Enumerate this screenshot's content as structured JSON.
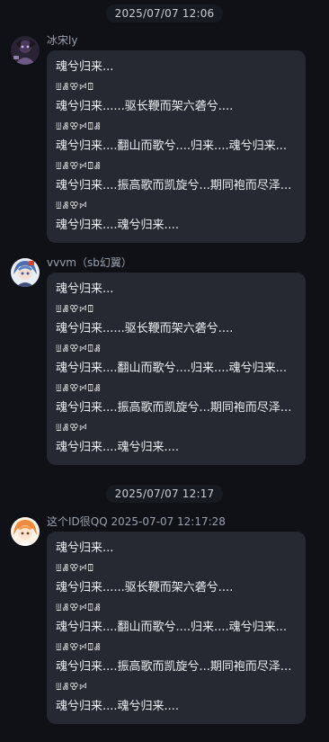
{
  "timestamps": {
    "first": "2025/07/07 12:06",
    "second": "2025/07/07 12:17"
  },
  "messages": [
    {
      "sender": "冰宋ly",
      "avatar_icon": "dark-anime-avatar-icon",
      "lines": [
        "魂兮归来...",
        "ꔗꗡꕢꗯꘖ",
        "魂兮归来......驱长鞭而架六砻兮....",
        "ꔗꗡꕢꗯꘖꗡ",
        "魂兮归来....翻山而歌兮....归来....魂兮归来...",
        "ꔗꗡꕢꗯꘖꗡ",
        "魂兮归来....振高歌而凯旋兮...期同袍而尽泽...",
        "ꔗꗡꕢꗯ",
        "魂兮归来....魂兮归来...."
      ]
    },
    {
      "sender": "vvvm（sb幻翼）",
      "avatar_icon": "blue-hair-anime-avatar-icon",
      "lines": [
        "魂兮归来...",
        "ꔗꗡꕢꗯꘖ",
        "魂兮归来......驱长鞭而架六砻兮....",
        "ꔗꗡꕢꗯꘖꗡ",
        "魂兮归来....翻山而歌兮....归来....魂兮归来...",
        "ꔗꗡꕢꗯꘖꗡ",
        "魂兮归来....振高歌而凯旋兮...期同袍而尽泽...",
        "ꔗꗡꕢꗯ",
        "魂兮归来....魂兮归来...."
      ]
    },
    {
      "sender": "这个ID很QQ 2025-07-07 12:17:28",
      "avatar_icon": "orange-hair-anime-avatar-icon",
      "lines": [
        "魂兮归来...",
        "ꔗꗡꕢꗯꘖ",
        "魂兮归来......驱长鞭而架六砻兮....",
        "ꔗꗡꕢꗯꘖꗡ",
        "魂兮归来....翻山而歌兮....归来....魂兮归来...",
        "ꔗꗡꕢꗯꘖꗡ",
        "魂兮归来....振高歌而凯旋兮...期同袍而尽泽...",
        "ꔗꗡꕢꗯ",
        "魂兮归来....魂兮归来...."
      ]
    }
  ],
  "colors": {
    "background": "#0f1117",
    "bubble": "#262932",
    "sender_text": "#9aa1ad"
  }
}
